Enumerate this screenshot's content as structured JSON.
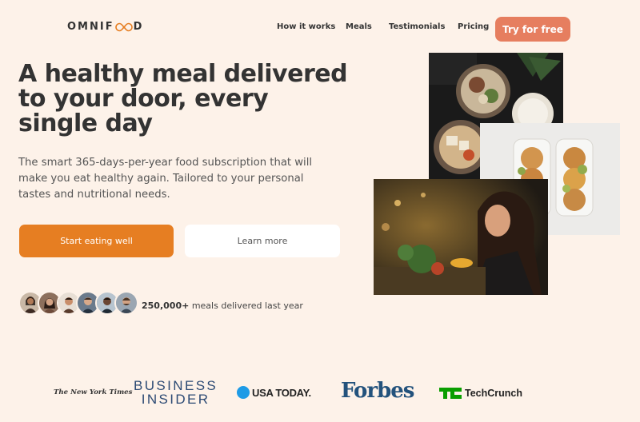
{
  "header": {
    "logo_left": "OMNIF",
    "logo_right": "D",
    "nav": [
      {
        "label": "How it works"
      },
      {
        "label": "Meals"
      },
      {
        "label": "Testimonials"
      },
      {
        "label": "Pricing"
      }
    ],
    "cta_label": "Try for free"
  },
  "hero": {
    "title": "A healthy meal delivered to your door, every single day",
    "description": "The smart 365-days-per-year food subscription that will make you eat healthy again. Tailored to your personal tastes and nutritional needs.",
    "primary_button": "Start eating well",
    "secondary_button": "Learn more",
    "delivered_count": "250,000+",
    "delivered_text": " meals delivered last year"
  },
  "featured_in": {
    "nyt": "The New York Times",
    "business_insider_line1": "BUSINESS",
    "business_insider_line2": "INSIDER",
    "usa_today": "USA TODAY.",
    "forbes": "Forbes",
    "techcrunch": "TechCrunch"
  },
  "colors": {
    "background": "#fdf2e9",
    "primary": "#e67e22",
    "cta": "#e67e5f"
  }
}
